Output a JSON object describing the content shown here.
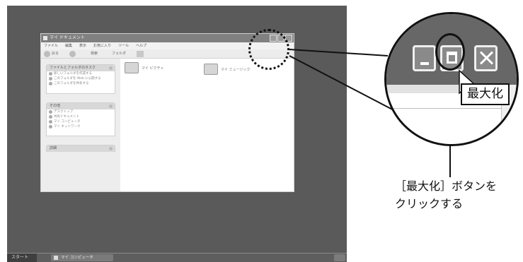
{
  "taskbar": {
    "start_label": "スタート",
    "window_item": "マイ コンピュータ"
  },
  "window": {
    "title": "マイ ドキュメント",
    "menu": [
      "ファイル",
      "編集",
      "表示",
      "お気に入り",
      "ツール",
      "ヘルプ"
    ],
    "toolbar": {
      "back": "戻る",
      "search": "検索",
      "folders": "フォルダ"
    },
    "panels": [
      {
        "header": "ファイルとフォルダのタスク",
        "items": [
          "新しいフォルダを作成する",
          "このフォルダを Web に公開する",
          "このフォルダを共有する"
        ]
      },
      {
        "header": "その他",
        "items": [
          "デスクトップ",
          "共有ドキュメント",
          "マイ コンピュータ",
          "マイ ネットワーク"
        ]
      },
      {
        "header": "詳細",
        "items": []
      }
    ],
    "folders": [
      "マイ ピクチャ",
      "マイ ミュージック"
    ]
  },
  "magnified": {
    "tooltip": "最大化"
  },
  "callout": {
    "line1": "［最大化］ボタンを",
    "line2": "クリックする"
  },
  "colors": {
    "desktop": "#5a5a5a",
    "titlebar": "#808080",
    "callout_line": "#111111"
  },
  "icons": [
    "minimize-icon",
    "maximize-icon",
    "close-icon",
    "mouse-pointer-icon",
    "folder-icon"
  ]
}
